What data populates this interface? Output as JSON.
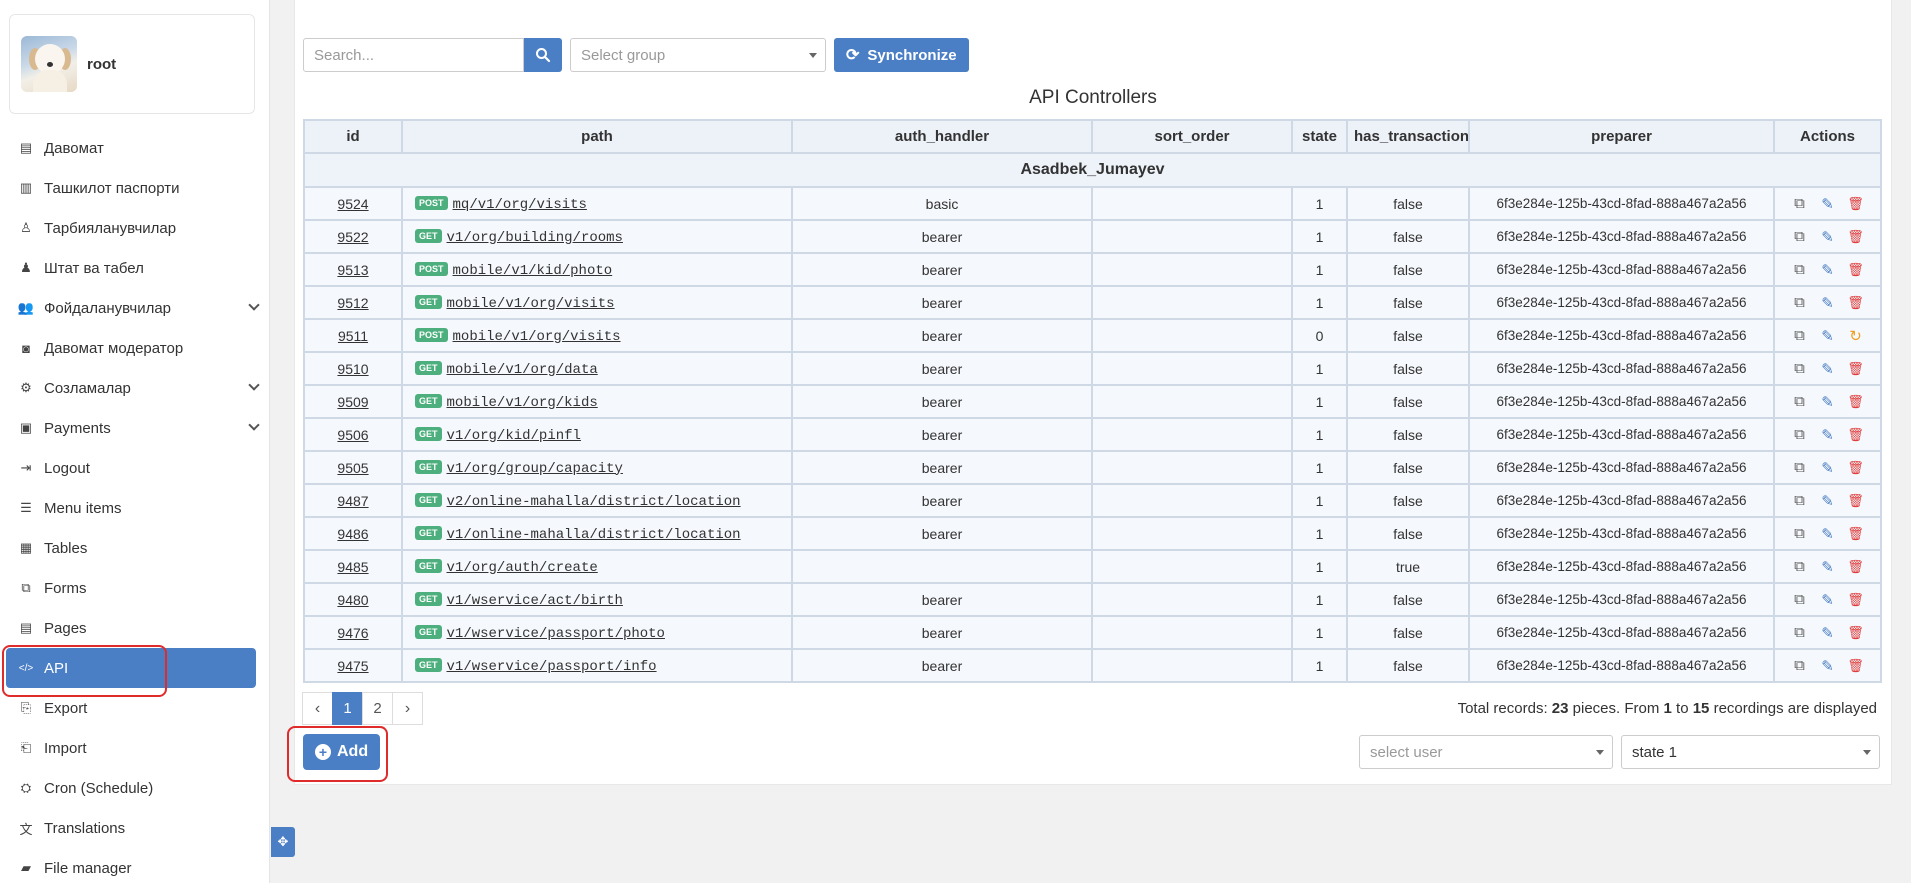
{
  "profile": {
    "name": "root"
  },
  "sidebar": {
    "items": [
      {
        "label": "Давомат",
        "icon": "id-card-icon",
        "expandable": false
      },
      {
        "label": "Ташкилот паспорти",
        "icon": "building-icon",
        "expandable": false
      },
      {
        "label": "Тарбияланувчилар",
        "icon": "child-icon",
        "expandable": false
      },
      {
        "label": "Штат ва табел",
        "icon": "person-icon",
        "expandable": false
      },
      {
        "label": "Фойдаланувчилар",
        "icon": "users-icon",
        "expandable": true
      },
      {
        "label": "Давомат модератор",
        "icon": "camera-icon",
        "expandable": false
      },
      {
        "label": "Созламалар",
        "icon": "gears-icon",
        "expandable": true
      },
      {
        "label": "Payments",
        "icon": "money-icon",
        "expandable": true
      },
      {
        "label": "Logout",
        "icon": "logout-icon",
        "expandable": false
      },
      {
        "label": "Menu items",
        "icon": "list-icon",
        "expandable": false
      },
      {
        "label": "Tables",
        "icon": "table-icon",
        "expandable": false
      },
      {
        "label": "Forms",
        "icon": "forms-icon",
        "expandable": false
      },
      {
        "label": "Pages",
        "icon": "pages-icon",
        "expandable": false
      },
      {
        "label": "API",
        "icon": "code-icon",
        "expandable": false,
        "active": true
      },
      {
        "label": "Export",
        "icon": "file-export-icon",
        "expandable": false
      },
      {
        "label": "Import",
        "icon": "file-import-icon",
        "expandable": false
      },
      {
        "label": "Cron (Schedule)",
        "icon": "clock-gear-icon",
        "expandable": false
      },
      {
        "label": "Translations",
        "icon": "language-icon",
        "expandable": false
      },
      {
        "label": "File manager",
        "icon": "folder-icon",
        "expandable": false
      }
    ]
  },
  "toolbar": {
    "search_placeholder": "Search...",
    "group_placeholder": "Select group",
    "sync_label": "Synchronize"
  },
  "table": {
    "title": "API Controllers",
    "columns": [
      "id",
      "path",
      "auth_handler",
      "sort_order",
      "state",
      "has_transaction",
      "preparer",
      "Actions"
    ],
    "group": "Asadbek_Jumayev",
    "rows": [
      {
        "id": "9524",
        "method": "POST",
        "path": "mq/v1/org/visits",
        "auth": "basic",
        "sort": "",
        "state": "1",
        "tx": "false",
        "preparer": "6f3e284e-125b-43cd-8fad-888a467a2a56",
        "third_action": "delete"
      },
      {
        "id": "9522",
        "method": "GET",
        "path": "v1/org/building/rooms",
        "auth": "bearer",
        "sort": "",
        "state": "1",
        "tx": "false",
        "preparer": "6f3e284e-125b-43cd-8fad-888a467a2a56",
        "third_action": "delete"
      },
      {
        "id": "9513",
        "method": "POST",
        "path": "mobile/v1/kid/photo",
        "auth": "bearer",
        "sort": "",
        "state": "1",
        "tx": "false",
        "preparer": "6f3e284e-125b-43cd-8fad-888a467a2a56",
        "third_action": "delete"
      },
      {
        "id": "9512",
        "method": "GET",
        "path": "mobile/v1/org/visits",
        "auth": "bearer",
        "sort": "",
        "state": "1",
        "tx": "false",
        "preparer": "6f3e284e-125b-43cd-8fad-888a467a2a56",
        "third_action": "delete"
      },
      {
        "id": "9511",
        "method": "POST",
        "path": "mobile/v1/org/visits",
        "auth": "bearer",
        "sort": "",
        "state": "0",
        "tx": "false",
        "preparer": "6f3e284e-125b-43cd-8fad-888a467a2a56",
        "third_action": "restore"
      },
      {
        "id": "9510",
        "method": "GET",
        "path": "mobile/v1/org/data",
        "auth": "bearer",
        "sort": "",
        "state": "1",
        "tx": "false",
        "preparer": "6f3e284e-125b-43cd-8fad-888a467a2a56",
        "third_action": "delete"
      },
      {
        "id": "9509",
        "method": "GET",
        "path": "mobile/v1/org/kids",
        "auth": "bearer",
        "sort": "",
        "state": "1",
        "tx": "false",
        "preparer": "6f3e284e-125b-43cd-8fad-888a467a2a56",
        "third_action": "delete"
      },
      {
        "id": "9506",
        "method": "GET",
        "path": "v1/org/kid/pinfl",
        "auth": "bearer",
        "sort": "",
        "state": "1",
        "tx": "false",
        "preparer": "6f3e284e-125b-43cd-8fad-888a467a2a56",
        "third_action": "delete"
      },
      {
        "id": "9505",
        "method": "GET",
        "path": "v1/org/group/capacity",
        "auth": "bearer",
        "sort": "",
        "state": "1",
        "tx": "false",
        "preparer": "6f3e284e-125b-43cd-8fad-888a467a2a56",
        "third_action": "delete"
      },
      {
        "id": "9487",
        "method": "GET",
        "path": "v2/online-mahalla/district/location",
        "auth": "bearer",
        "sort": "",
        "state": "1",
        "tx": "false",
        "preparer": "6f3e284e-125b-43cd-8fad-888a467a2a56",
        "third_action": "delete"
      },
      {
        "id": "9486",
        "method": "GET",
        "path": "v1/online-mahalla/district/location",
        "auth": "bearer",
        "sort": "",
        "state": "1",
        "tx": "false",
        "preparer": "6f3e284e-125b-43cd-8fad-888a467a2a56",
        "third_action": "delete"
      },
      {
        "id": "9485",
        "method": "GET",
        "path": "v1/org/auth/create",
        "auth": "",
        "sort": "",
        "state": "1",
        "tx": "true",
        "preparer": "6f3e284e-125b-43cd-8fad-888a467a2a56",
        "third_action": "delete"
      },
      {
        "id": "9480",
        "method": "GET",
        "path": "v1/wservice/act/birth",
        "auth": "bearer",
        "sort": "",
        "state": "1",
        "tx": "false",
        "preparer": "6f3e284e-125b-43cd-8fad-888a467a2a56",
        "third_action": "delete"
      },
      {
        "id": "9476",
        "method": "GET",
        "path": "v1/wservice/passport/photo",
        "auth": "bearer",
        "sort": "",
        "state": "1",
        "tx": "false",
        "preparer": "6f3e284e-125b-43cd-8fad-888a467a2a56",
        "third_action": "delete"
      },
      {
        "id": "9475",
        "method": "GET",
        "path": "v1/wservice/passport/info",
        "auth": "bearer",
        "sort": "",
        "state": "1",
        "tx": "false",
        "preparer": "6f3e284e-125b-43cd-8fad-888a467a2a56",
        "third_action": "delete"
      }
    ]
  },
  "pagination": {
    "pages": [
      "1",
      "2"
    ],
    "current": "1",
    "total_prefix": "Total records: ",
    "total_count": "23",
    "total_mid": " pieces. From ",
    "from": "1",
    "to_word": " to ",
    "to": "15",
    "total_suffix": " recordings are displayed"
  },
  "footer": {
    "add_label": "Add",
    "user_placeholder": "select user",
    "state_value": "state 1"
  },
  "colors": {
    "accent": "#4b7fc5",
    "method_badge": "#4caf7d",
    "delete": "#e03a3a",
    "restore": "#f0a020",
    "highlight": "#e02b2b"
  }
}
